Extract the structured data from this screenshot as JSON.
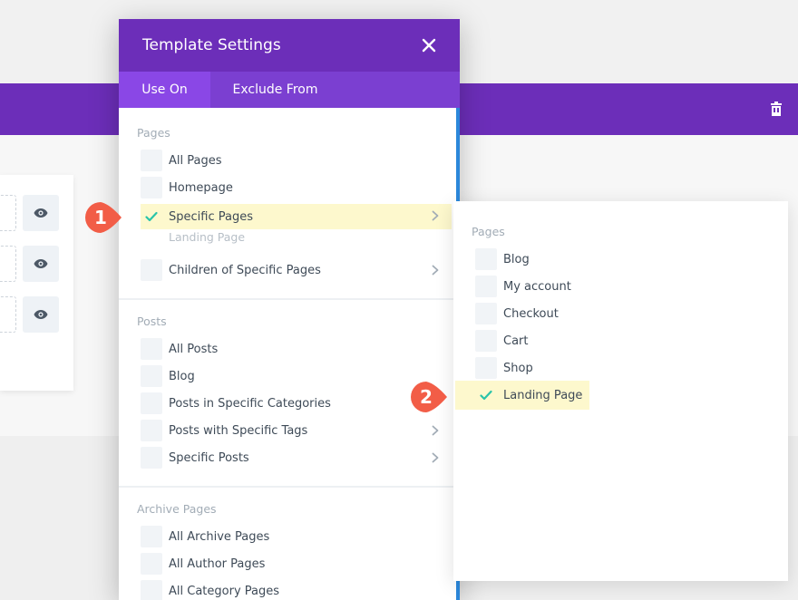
{
  "modal": {
    "title": "Template Settings",
    "tabs": [
      {
        "label": "Use On",
        "active": true
      },
      {
        "label": "Exclude From",
        "active": false
      }
    ],
    "pages_section": {
      "label": "Pages",
      "items": [
        {
          "label": "All Pages",
          "checked": false
        },
        {
          "label": "Homepage",
          "checked": false
        },
        {
          "label": "Specific Pages",
          "checked": true,
          "sub_label": "Landing Page"
        },
        {
          "label": "Children of Specific Pages",
          "checked": false
        }
      ]
    },
    "posts_section": {
      "label": "Posts",
      "items": [
        {
          "label": "All Posts",
          "checked": false
        },
        {
          "label": "Blog",
          "checked": false
        },
        {
          "label": "Posts in Specific Categories",
          "checked": false
        },
        {
          "label": "Posts with Specific Tags",
          "checked": false
        },
        {
          "label": "Specific Posts",
          "checked": false
        }
      ]
    },
    "archive_section": {
      "label": "Archive Pages",
      "items": [
        {
          "label": "All Archive Pages",
          "checked": false
        },
        {
          "label": "All Author Pages",
          "checked": false
        },
        {
          "label": "All Category Pages",
          "checked": false
        }
      ]
    }
  },
  "panel": {
    "section_label": "Pages",
    "items": [
      {
        "label": "Blog",
        "checked": false
      },
      {
        "label": "My account",
        "checked": false
      },
      {
        "label": "Checkout",
        "checked": false
      },
      {
        "label": "Cart",
        "checked": false
      },
      {
        "label": "Shop",
        "checked": false
      },
      {
        "label": "Landing Page",
        "checked": true
      }
    ]
  },
  "badges": [
    {
      "text": "1"
    },
    {
      "text": "2"
    }
  ],
  "colors": {
    "purple": "#6c2eb9",
    "tab_bar": "#7b3fd1",
    "active_tab": "#8a47e6",
    "check_green": "#29c4a9",
    "badge_red": "#f25d47",
    "highlight": "#fdf8cd",
    "scrollbar": "#2b87da"
  }
}
